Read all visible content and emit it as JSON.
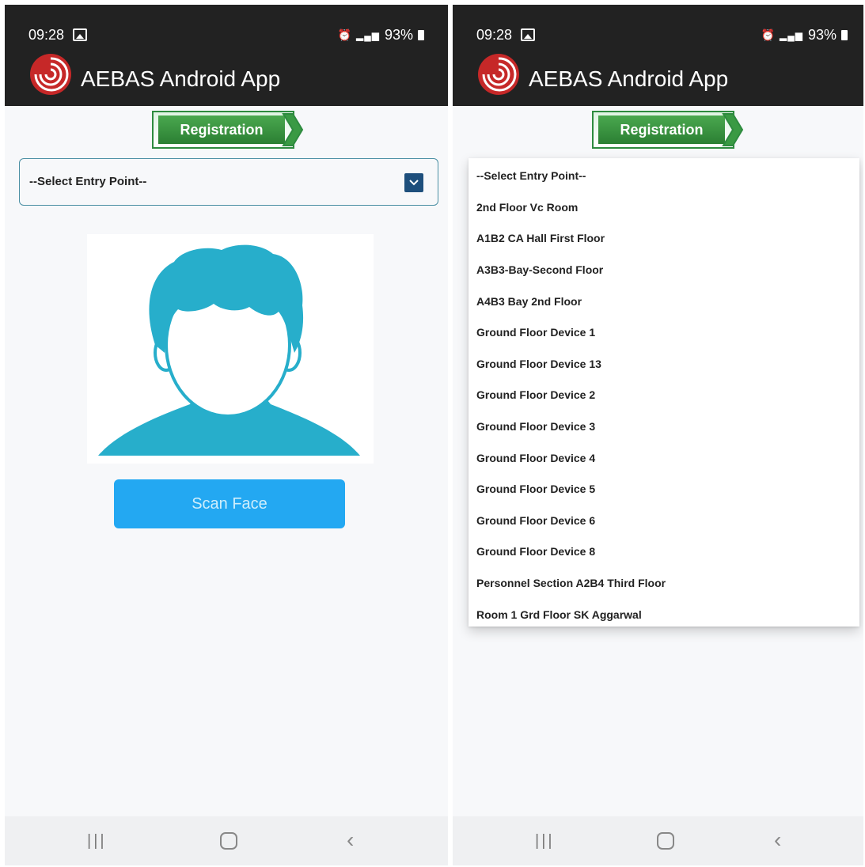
{
  "status_bar": {
    "time": "09:28",
    "battery": "93%"
  },
  "app_bar": {
    "title": "AEBAS Android App"
  },
  "registration_label": "Registration",
  "entry_point_select": {
    "selected": "--Select Entry Point--"
  },
  "scan_face_label": "Scan Face",
  "dropdown_options": [
    "--Select Entry Point--",
    "2nd Floor Vc Room",
    "A1B2 CA Hall First Floor",
    "A3B3-Bay-Second Floor",
    "A4B3 Bay 2nd Floor",
    "Ground Floor Device 1",
    "Ground Floor Device 13",
    "Ground Floor Device 2",
    "Ground Floor Device 3",
    "Ground Floor Device 4",
    "Ground Floor Device 5",
    "Ground Floor Device 6",
    "Ground Floor Device 8",
    "Personnel Section A2B4 Third Floor",
    "Room 1 Grd Floor SK Aggarwal"
  ],
  "icons": {
    "logo": "fingerprint-logo-icon",
    "avatar": "person-silhouette-icon",
    "select": "chevron-down-icon",
    "nav": [
      "recent-apps-icon",
      "home-icon",
      "back-icon"
    ]
  },
  "colors": {
    "app_bar": "#222222",
    "registration_green": "#2e8b3f",
    "scan_button": "#23a8f2",
    "avatar_teal": "#27aecb",
    "select_button": "#1e4f7c"
  }
}
